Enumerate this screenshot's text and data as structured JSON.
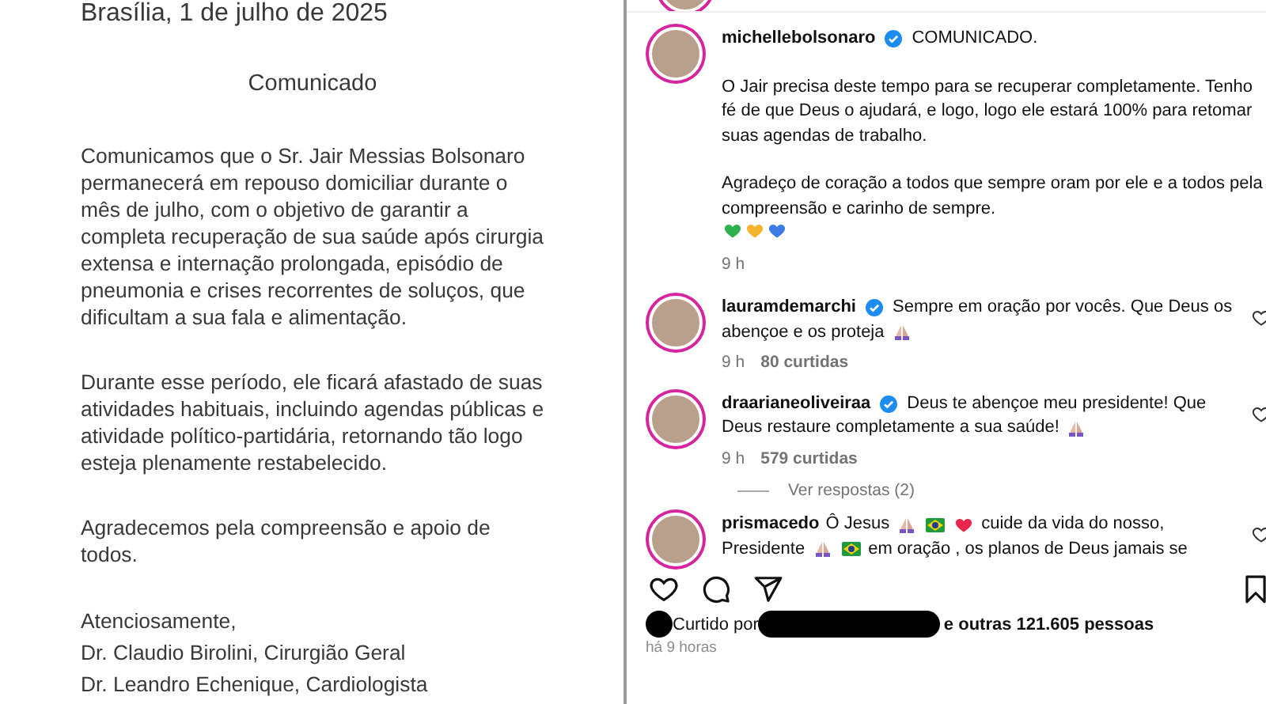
{
  "document": {
    "place_date": "Brasília, 1 de julho de 2025",
    "title": "Comunicado",
    "paragraphs": [
      "Comunicamos que o Sr. Jair Messias Bolsonaro permanecerá em repouso domiciliar durante o mês de julho, com o objetivo de garantir a completa recuperação de sua saúde após cirurgia extensa e internação prolongada, episódio de pneumonia e crises recorrentes de soluços, que dificultam a sua fala e alimentação.",
      "Durante esse período, ele ficará afastado de suas atividades habituais, incluindo agendas públicas e atividade político-partidária, retornando tão logo esteja plenamente restabelecido.",
      "Agradecemos pela compreensão e apoio de todos."
    ],
    "closing": "Atenciosamente,",
    "signatures": [
      "Dr. Claudio Birolini, Cirurgião Geral",
      "Dr. Leandro Echenique, Cardiologista"
    ]
  },
  "post": {
    "username": "michellebolsonaro",
    "verified": true,
    "caption_title": "COMUNICADO.",
    "caption_paragraphs": [
      "O Jair precisa deste tempo para se recuperar completamente. Tenho fé de que Deus o ajudará, e logo, logo ele estará 100% para retomar suas agendas de trabalho.",
      "Agradeço de coração a todos que sempre oram por ele e a todos pela compreensão e carinho de sempre."
    ],
    "caption_emojis": [
      {
        "kind": "heart",
        "color": "#2fb14e"
      },
      {
        "kind": "heart",
        "color": "#f4b52c"
      },
      {
        "kind": "heart",
        "color": "#3b7be3"
      }
    ],
    "time": "9 h"
  },
  "comments": [
    {
      "username": "lauramdemarchi",
      "verified": true,
      "lines": [
        [
          {
            "kind": "text",
            "text": "Sempre em oração por vocês. Que Deus os"
          }
        ],
        [
          {
            "kind": "text",
            "text": "abençoe e os proteja"
          },
          {
            "kind": "pray"
          }
        ]
      ],
      "time": "9 h",
      "likes": "80 curtidas"
    },
    {
      "username": "draarianeoliveiraa",
      "verified": true,
      "lines": [
        [
          {
            "kind": "text",
            "text": "Deus te abençoe meu presidente! Que"
          }
        ],
        [
          {
            "kind": "text",
            "text": "Deus restaure completamente a sua saúde!"
          },
          {
            "kind": "pray"
          }
        ]
      ],
      "time": "9 h",
      "likes": "579 curtidas",
      "replies": "Ver respostas (2)"
    },
    {
      "username": "prismacedo",
      "verified": false,
      "lines": [
        [
          {
            "kind": "text",
            "text": "Ô Jesus"
          },
          {
            "kind": "pray"
          },
          {
            "kind": "flag"
          },
          {
            "kind": "heart"
          },
          {
            "kind": "text",
            "text": "cuide da vida do nosso,"
          }
        ],
        [
          {
            "kind": "text",
            "text": "Presidente"
          },
          {
            "kind": "pray"
          },
          {
            "kind": "flag"
          },
          {
            "kind": "text",
            "text": "em oração , os planos de Deus jamais se"
          }
        ]
      ]
    }
  ],
  "liked": {
    "prefix": "Curtido por",
    "suffix": "e outras 121.605 pessoas"
  },
  "post_time": "há 9 horas"
}
